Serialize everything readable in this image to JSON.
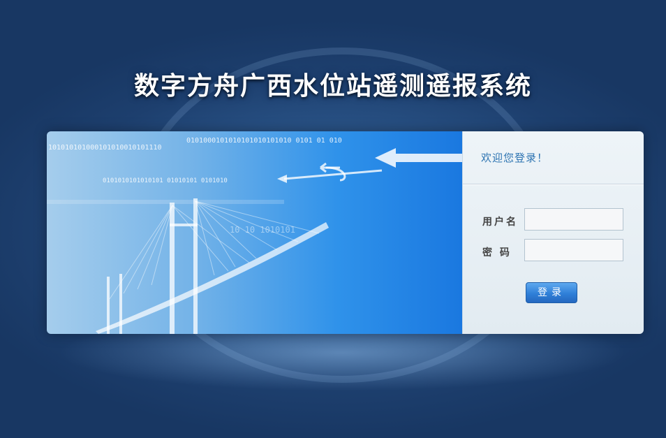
{
  "app": {
    "title": "数字方舟广西水位站遥测遥报系统"
  },
  "banner": {
    "binary_lines": [
      "0101000101010101010101010   0101   01 010",
      "101010101000101010010101110",
      "0101010101010101  01010101  0101010",
      "10  10  1010101"
    ]
  },
  "login": {
    "welcome": "欢迎您登录！",
    "username_label": "用户名",
    "password_label": "密 码",
    "username_value": "",
    "password_value": "",
    "submit_label": "登录"
  },
  "colors": {
    "background": "#1d3f6e",
    "accent": "#2f7fd8",
    "welcome_text": "#2e74b2"
  }
}
